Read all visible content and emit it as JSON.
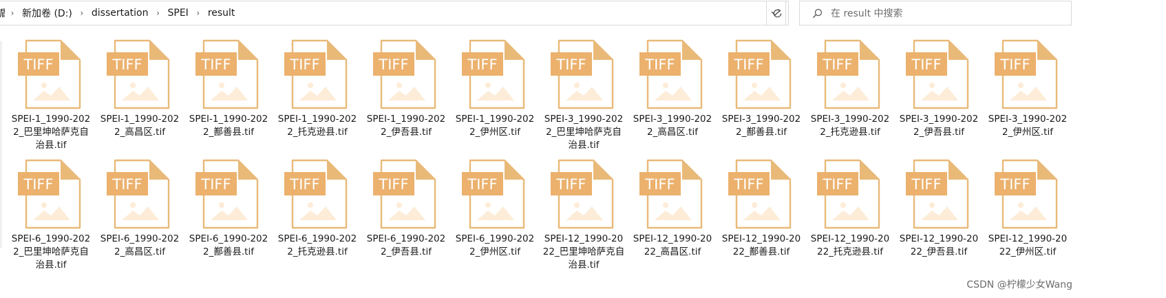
{
  "address_bar": {
    "fragment": "盾",
    "path": [
      "新加卷 (D:)",
      "dissertation",
      "SPEI",
      "result"
    ]
  },
  "search": {
    "placeholder": "在 result 中搜索"
  },
  "icons": {
    "chevron": "chevron-right-icon",
    "dropdown": "chevron-down-icon",
    "refresh": "refresh-icon",
    "search": "search-icon",
    "file": "tiff-file-icon"
  },
  "colors": {
    "tiff_badge": "#ebb16d",
    "file_outline": "#e9b978",
    "mountain": "#fdecd7"
  },
  "file_badge_text": "TIFF",
  "files": [
    {
      "name": "SPEI-1_1990-2022_巴里坤哈萨克自治县.tif"
    },
    {
      "name": "SPEI-1_1990-2022_高昌区.tif"
    },
    {
      "name": "SPEI-1_1990-2022_鄯善县.tif"
    },
    {
      "name": "SPEI-1_1990-2022_托克逊县.tif"
    },
    {
      "name": "SPEI-1_1990-2022_伊吾县.tif"
    },
    {
      "name": "SPEI-1_1990-2022_伊州区.tif"
    },
    {
      "name": "SPEI-3_1990-2022_巴里坤哈萨克自治县.tif"
    },
    {
      "name": "SPEI-3_1990-2022_高昌区.tif"
    },
    {
      "name": "SPEI-3_1990-2022_鄯善县.tif"
    },
    {
      "name": "SPEI-3_1990-2022_托克逊县.tif"
    },
    {
      "name": "SPEI-3_1990-2022_伊吾县.tif"
    },
    {
      "name": "SPEI-3_1990-2022_伊州区.tif"
    },
    {
      "name": "SPEI-6_1990-2022_巴里坤哈萨克自治县.tif"
    },
    {
      "name": "SPEI-6_1990-2022_高昌区.tif"
    },
    {
      "name": "SPEI-6_1990-2022_鄯善县.tif"
    },
    {
      "name": "SPEI-6_1990-2022_托克逊县.tif"
    },
    {
      "name": "SPEI-6_1990-2022_伊吾县.tif"
    },
    {
      "name": "SPEI-6_1990-2022_伊州区.tif"
    },
    {
      "name": "SPEI-12_1990-2022_巴里坤哈萨克自治县.tif"
    },
    {
      "name": "SPEI-12_1990-2022_高昌区.tif"
    },
    {
      "name": "SPEI-12_1990-2022_鄯善县.tif"
    },
    {
      "name": "SPEI-12_1990-2022_托克逊县.tif"
    },
    {
      "name": "SPEI-12_1990-2022_伊吾县.tif"
    },
    {
      "name": "SPEI-12_1990-2022_伊州区.tif"
    }
  ],
  "watermark": "CSDN @柠檬少女Wang"
}
